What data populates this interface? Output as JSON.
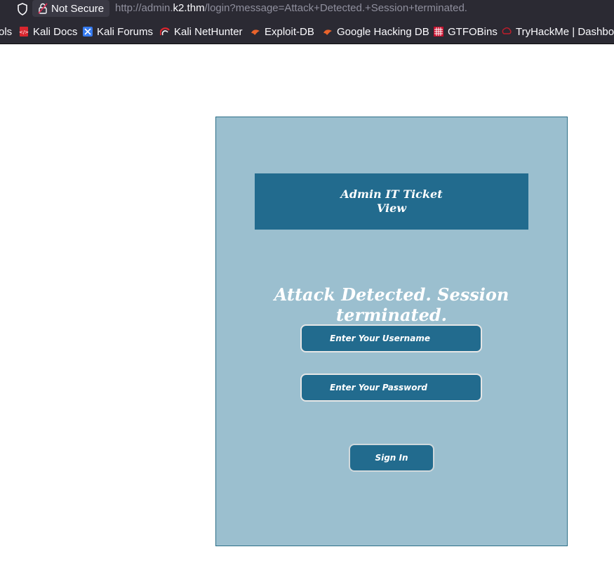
{
  "browser": {
    "security_label": "Not Secure",
    "url_prefix": "http://admin.",
    "url_host": "k2.thm",
    "url_path": "/login?message=Attack+Detected.+Session+terminated."
  },
  "bookmarks": [
    {
      "label": "ols",
      "icon": "folder-icon"
    },
    {
      "label": "Kali Docs",
      "icon": "kali-docs-icon"
    },
    {
      "label": "Kali Forums",
      "icon": "kali-forums-icon"
    },
    {
      "label": "Kali NetHunter",
      "icon": "nethunter-icon"
    },
    {
      "label": "Exploit-DB",
      "icon": "exploit-db-icon"
    },
    {
      "label": "Google Hacking DB",
      "icon": "ghdb-icon"
    },
    {
      "label": "GTFOBins",
      "icon": "gtfobins-icon"
    },
    {
      "label": "TryHackMe | Dashboa",
      "icon": "tryhackme-icon"
    }
  ],
  "page": {
    "title_line1": "Admin IT Ticket",
    "title_line2": "View",
    "alert_message": "Attack Detected. Session terminated.",
    "username_placeholder": "Enter Your Username",
    "password_placeholder": "Enter Your Password",
    "signin_label": "Sign In"
  },
  "colors": {
    "panel_bg": "#9bbfcf",
    "accent": "#226b8e",
    "chrome_bg": "#2b2a33"
  }
}
